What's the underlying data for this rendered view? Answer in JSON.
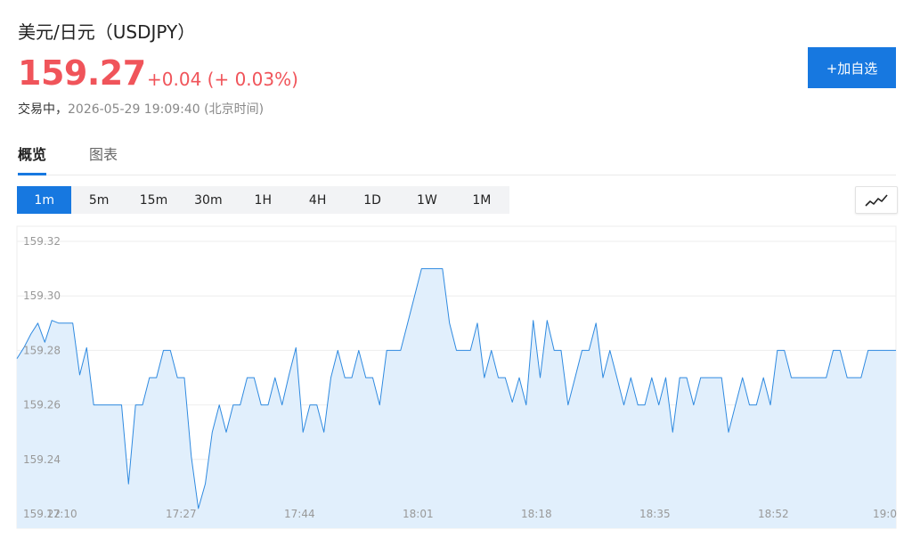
{
  "header": {
    "title": "美元/日元（USDJPY）",
    "price": "159.27",
    "change": "+0.04 (+ 0.03%)",
    "status": "交易中，",
    "timestamp": "2026-05-29 19:09:40 (北京时间)",
    "add_button": "+加自选"
  },
  "tabs": [
    {
      "label": "概览",
      "active": true
    },
    {
      "label": "图表",
      "active": false
    }
  ],
  "periods": [
    {
      "label": "1m",
      "active": true
    },
    {
      "label": "5m",
      "active": false
    },
    {
      "label": "15m",
      "active": false
    },
    {
      "label": "30m",
      "active": false
    },
    {
      "label": "1H",
      "active": false
    },
    {
      "label": "4H",
      "active": false
    },
    {
      "label": "1D",
      "active": false
    },
    {
      "label": "1W",
      "active": false
    },
    {
      "label": "1M",
      "active": false
    }
  ],
  "chart_type_icon": "line-chart-icon",
  "colors": {
    "up": "#f0545a",
    "accent": "#1778e0",
    "line": "#2f8ae0",
    "area": "#e1effc"
  },
  "chart_data": {
    "type": "area",
    "y_ticks": [
      "159.32",
      "159.30",
      "159.28",
      "159.26",
      "159.24",
      "159.22"
    ],
    "ylim": [
      159.22,
      159.32
    ],
    "grid": true,
    "x_ticks": [
      "17:10",
      "17:27",
      "17:44",
      "18:01",
      "18:18",
      "18:35",
      "18:52",
      "19:0"
    ],
    "series": [
      {
        "values": [
          159.277,
          159.281,
          159.286,
          159.29,
          159.283,
          159.291,
          159.29,
          159.29,
          159.29,
          159.271,
          159.281,
          159.26,
          159.26,
          159.26,
          159.26,
          159.26,
          159.231,
          159.26,
          159.26,
          159.27,
          159.27,
          159.28,
          159.28,
          159.27,
          159.27,
          159.241,
          159.222,
          159.231,
          159.25,
          159.26,
          159.25,
          159.26,
          159.26,
          159.27,
          159.27,
          159.26,
          159.26,
          159.27,
          159.26,
          159.271,
          159.281,
          159.25,
          159.26,
          159.26,
          159.25,
          159.27,
          159.28,
          159.27,
          159.27,
          159.28,
          159.27,
          159.27,
          159.26,
          159.28,
          159.28,
          159.28,
          159.29,
          159.3,
          159.31,
          159.31,
          159.31,
          159.31,
          159.29,
          159.28,
          159.28,
          159.28,
          159.29,
          159.27,
          159.28,
          159.27,
          159.27,
          159.261,
          159.27,
          159.26,
          159.291,
          159.27,
          159.291,
          159.28,
          159.28,
          159.26,
          159.27,
          159.28,
          159.28,
          159.29,
          159.27,
          159.28,
          159.27,
          159.26,
          159.27,
          159.26,
          159.26,
          159.27,
          159.26,
          159.27,
          159.25,
          159.27,
          159.27,
          159.26,
          159.27,
          159.27,
          159.27,
          159.27,
          159.25,
          159.26,
          159.27,
          159.26,
          159.26,
          159.27,
          159.26,
          159.28,
          159.28,
          159.27,
          159.27,
          159.27,
          159.27,
          159.27,
          159.27,
          159.28,
          159.28,
          159.27,
          159.27,
          159.27,
          159.28,
          159.28,
          159.28,
          159.28,
          159.28
        ]
      }
    ]
  }
}
